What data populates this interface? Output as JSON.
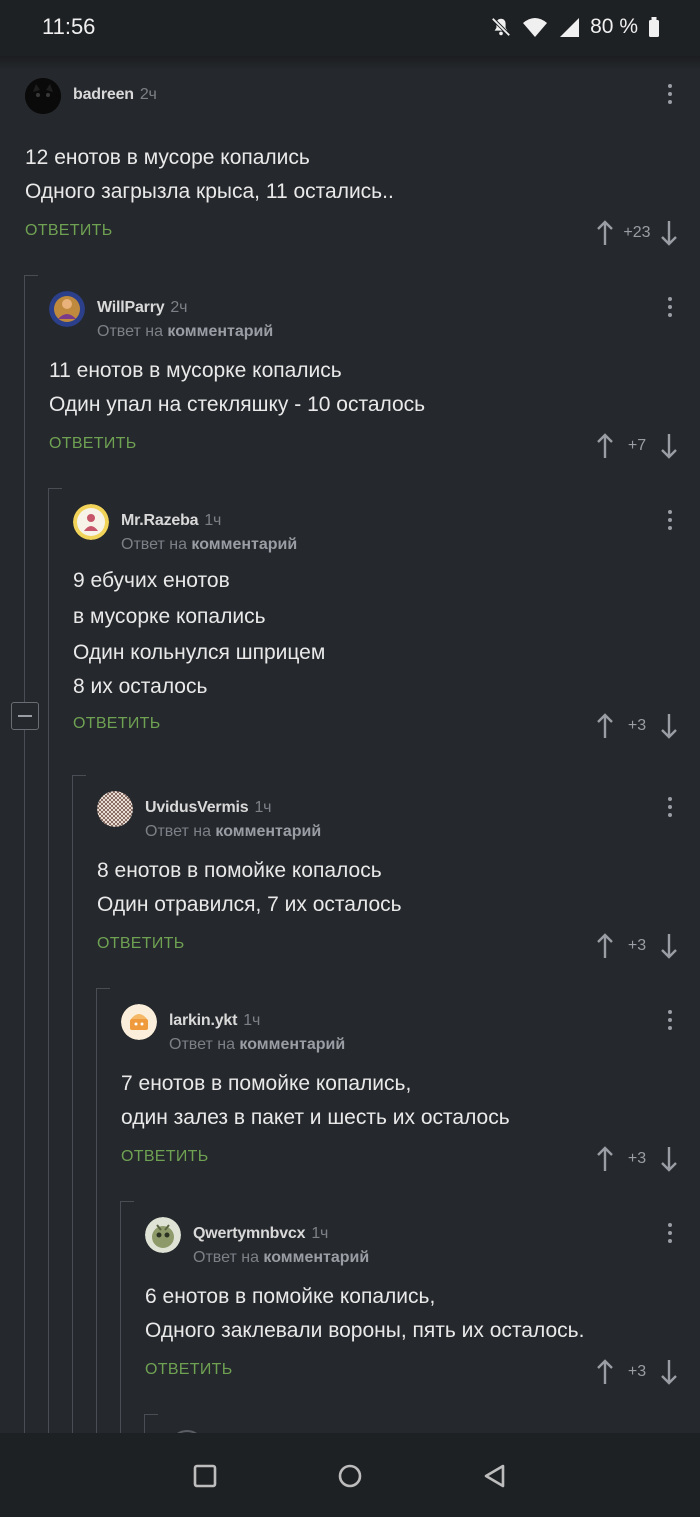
{
  "status_bar": {
    "time": "11:56",
    "battery": "80 %"
  },
  "labels": {
    "reply": "ОТВЕТИТЬ",
    "reply_to_prefix": "Ответ на",
    "reply_to_target": "комментарий"
  },
  "comments": [
    {
      "author": "badreen",
      "time": "2ч",
      "lines": [
        "12 енотов в мусоре копались",
        "Одного загрызла крыса, 11 остались.."
      ],
      "votes": "+23"
    },
    {
      "author": "WillParry",
      "time": "2ч",
      "lines": [
        "11 енотов в мусорке копались",
        "Один упал на стекляшку - 10 осталось"
      ],
      "votes": "+7"
    },
    {
      "author": "Mr.Razeba",
      "time": "1ч",
      "lines": [
        "9 ебучих енотов",
        "в мусорке копались",
        "Один кольнулся шприцем",
        "8 их осталось"
      ],
      "votes": "+3"
    },
    {
      "author": "UvidusVermis",
      "time": "1ч",
      "lines": [
        "8 енотов в помойке копалось",
        "Один отравился, 7 их осталось"
      ],
      "votes": "+3"
    },
    {
      "author": "larkin.ykt",
      "time": "1ч",
      "lines": [
        "7 енотов в помойке копались,",
        "один залез в пакет и шесть их осталось"
      ],
      "votes": "+3"
    },
    {
      "author": "Qwertymnbvcx",
      "time": "1ч",
      "lines": [
        "6 енотов в помойке копались,",
        "Одного заклевали вороны, пять их осталось."
      ],
      "votes": "+3"
    }
  ],
  "colors": {
    "background": "#25282c",
    "accent_reply": "#6fa153",
    "muted": "#7d8187",
    "thread_line": "#4a4e54"
  }
}
